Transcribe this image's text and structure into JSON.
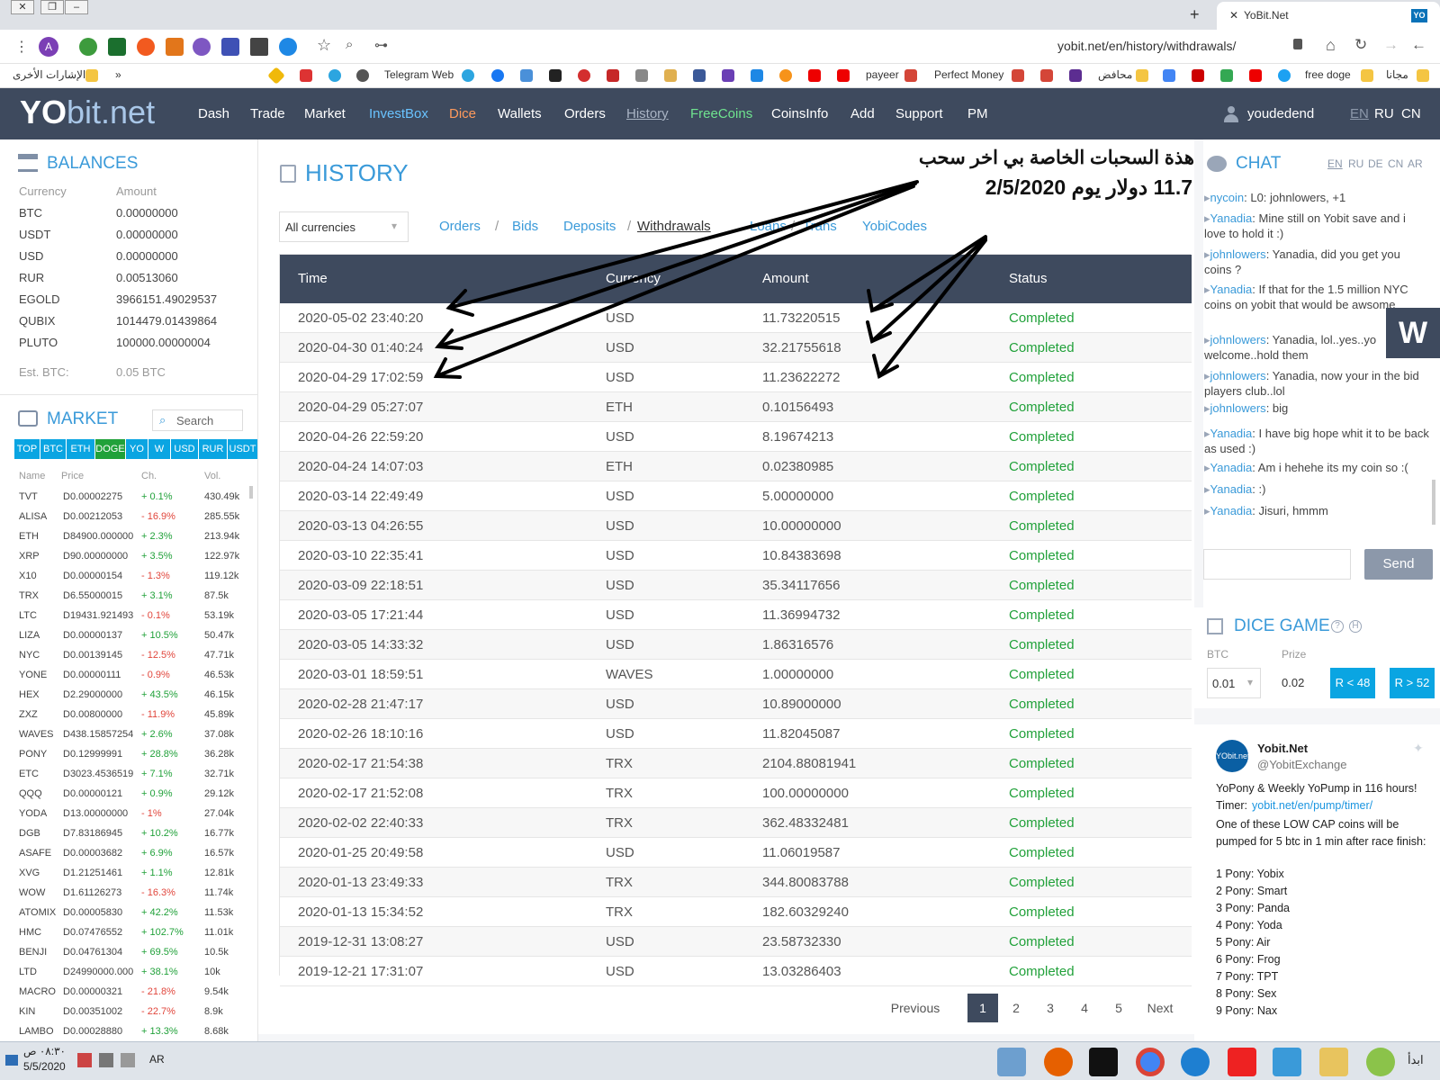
{
  "browser": {
    "tab_title": "YoBit.Net",
    "address": "yobit.net/en/history/withdrawals/",
    "profile_letter": "A",
    "ext_badge": "YO",
    "bookmarks": [
      {
        "label": "Telegram Web"
      },
      {
        "label": "payeer"
      },
      {
        "label": "Perfect Money"
      },
      {
        "label": "محافض"
      },
      {
        "label": "free doge"
      },
      {
        "label": "مجانا"
      }
    ],
    "bookmarks_other": "الإشارات الأخرى",
    "bookmarks_more": "»"
  },
  "nav": {
    "logo_yo": "YO",
    "logo_rest": "bit.net",
    "items": [
      "Dash",
      "Trade",
      "Market",
      "InvestBox",
      "Dice",
      "Wallets",
      "Orders",
      "History",
      "FreeCoins",
      "CoinsInfo",
      "Add",
      "Support",
      "PM"
    ],
    "username": "youdedend",
    "langs": [
      "EN",
      "RU",
      "CN"
    ]
  },
  "balances": {
    "title": "BALANCES",
    "col_currency": "Currency",
    "col_amount": "Amount",
    "rows": [
      {
        "currency": "BTC",
        "amount": "0.00000000"
      },
      {
        "currency": "USDT",
        "amount": "0.00000000"
      },
      {
        "currency": "USD",
        "amount": "0.00000000"
      },
      {
        "currency": "RUR",
        "amount": "0.00513060"
      },
      {
        "currency": "EGOLD",
        "amount": "3966151.49029537"
      },
      {
        "currency": "QUBIX",
        "amount": "1014479.01439864"
      },
      {
        "currency": "PLUTO",
        "amount": "100000.00000004"
      }
    ],
    "est_label": "Est. BTC:",
    "est_value": "0.05 BTC"
  },
  "market": {
    "title": "MARKET",
    "search_placeholder": "Search",
    "tabs": [
      "TOP",
      "BTC",
      "ETH",
      "DOGE",
      "YO",
      "W",
      "USD",
      "RUR",
      "USDT"
    ],
    "cols": [
      "Name",
      "Price",
      "Ch.",
      "Vol."
    ],
    "rows": [
      {
        "name": "TVT",
        "price": "D0.00002275",
        "ch": "+ 0.1%",
        "vol": "430.49k",
        "up": true
      },
      {
        "name": "ALISA",
        "price": "D0.00212053",
        "ch": "- 16.9%",
        "vol": "285.55k",
        "up": false
      },
      {
        "name": "ETH",
        "price": "D84900.000000",
        "ch": "+ 2.3%",
        "vol": "213.94k",
        "up": true
      },
      {
        "name": "XRP",
        "price": "D90.00000000",
        "ch": "+ 3.5%",
        "vol": "122.97k",
        "up": true
      },
      {
        "name": "X10",
        "price": "D0.00000154",
        "ch": "- 1.3%",
        "vol": "119.12k",
        "up": false
      },
      {
        "name": "TRX",
        "price": "D6.55000015",
        "ch": "+ 3.1%",
        "vol": "87.5k",
        "up": true
      },
      {
        "name": "LTC",
        "price": "D19431.921493",
        "ch": "- 0.1%",
        "vol": "53.19k",
        "up": false
      },
      {
        "name": "LIZA",
        "price": "D0.00000137",
        "ch": "+ 10.5%",
        "vol": "50.47k",
        "up": true
      },
      {
        "name": "NYC",
        "price": "D0.00139145",
        "ch": "- 12.5%",
        "vol": "47.71k",
        "up": false
      },
      {
        "name": "YONE",
        "price": "D0.00000111",
        "ch": "- 0.9%",
        "vol": "46.53k",
        "up": false
      },
      {
        "name": "HEX",
        "price": "D2.29000000",
        "ch": "+ 43.5%",
        "vol": "46.15k",
        "up": true
      },
      {
        "name": "ZXZ",
        "price": "D0.00800000",
        "ch": "- 11.9%",
        "vol": "45.89k",
        "up": false
      },
      {
        "name": "WAVES",
        "price": "D438.15857254",
        "ch": "+ 2.6%",
        "vol": "37.08k",
        "up": true
      },
      {
        "name": "PONY",
        "price": "D0.12999991",
        "ch": "+ 28.8%",
        "vol": "36.28k",
        "up": true
      },
      {
        "name": "ETC",
        "price": "D3023.4536519",
        "ch": "+ 7.1%",
        "vol": "32.71k",
        "up": true
      },
      {
        "name": "QQQ",
        "price": "D0.00000121",
        "ch": "+ 0.9%",
        "vol": "29.12k",
        "up": true
      },
      {
        "name": "YODA",
        "price": "D13.00000000",
        "ch": "- 1%",
        "vol": "27.04k",
        "up": false
      },
      {
        "name": "DGB",
        "price": "D7.83186945",
        "ch": "+ 10.2%",
        "vol": "16.77k",
        "up": true
      },
      {
        "name": "ASAFE",
        "price": "D0.00003682",
        "ch": "+ 6.9%",
        "vol": "16.57k",
        "up": true
      },
      {
        "name": "XVG",
        "price": "D1.21251461",
        "ch": "+ 1.1%",
        "vol": "12.81k",
        "up": true
      },
      {
        "name": "WOW",
        "price": "D1.61126273",
        "ch": "- 16.3%",
        "vol": "11.74k",
        "up": false
      },
      {
        "name": "ATOMIX",
        "price": "D0.00005830",
        "ch": "+ 42.2%",
        "vol": "11.53k",
        "up": true
      },
      {
        "name": "HMC",
        "price": "D0.07476552",
        "ch": "+ 102.7%",
        "vol": "11.01k",
        "up": true
      },
      {
        "name": "BENJI",
        "price": "D0.04761304",
        "ch": "+ 69.5%",
        "vol": "10.5k",
        "up": true
      },
      {
        "name": "LTD",
        "price": "D24990000.000",
        "ch": "+ 38.1%",
        "vol": "10k",
        "up": true
      },
      {
        "name": "MACRO",
        "price": "D0.00000321",
        "ch": "- 21.8%",
        "vol": "9.54k",
        "up": false
      },
      {
        "name": "KIN",
        "price": "D0.00351002",
        "ch": "- 22.7%",
        "vol": "8.9k",
        "up": false
      },
      {
        "name": "LAMBO",
        "price": "D0.00028880",
        "ch": "+ 13.3%",
        "vol": "8.68k",
        "up": true
      }
    ]
  },
  "history": {
    "title": "HISTORY",
    "currency_select": "All currencies",
    "links": [
      "Orders",
      "Bids",
      "Deposits",
      "Withdrawals",
      "Loans",
      "Trans",
      "YobiCodes"
    ],
    "columns": [
      "Time",
      "Currency",
      "Amount",
      "Status"
    ],
    "rows": [
      {
        "time": "2020-05-02 23:40:20",
        "currency": "USD",
        "amount": "11.73220515",
        "status": "Completed"
      },
      {
        "time": "2020-04-30 01:40:24",
        "currency": "USD",
        "amount": "32.21755618",
        "status": "Completed"
      },
      {
        "time": "2020-04-29 17:02:59",
        "currency": "USD",
        "amount": "11.23622272",
        "status": "Completed"
      },
      {
        "time": "2020-04-29 05:27:07",
        "currency": "ETH",
        "amount": "0.10156493",
        "status": "Completed"
      },
      {
        "time": "2020-04-26 22:59:20",
        "currency": "USD",
        "amount": "8.19674213",
        "status": "Completed"
      },
      {
        "time": "2020-04-24 14:07:03",
        "currency": "ETH",
        "amount": "0.02380985",
        "status": "Completed"
      },
      {
        "time": "2020-03-14 22:49:49",
        "currency": "USD",
        "amount": "5.00000000",
        "status": "Completed"
      },
      {
        "time": "2020-03-13 04:26:55",
        "currency": "USD",
        "amount": "10.00000000",
        "status": "Completed"
      },
      {
        "time": "2020-03-10 22:35:41",
        "currency": "USD",
        "amount": "10.84383698",
        "status": "Completed"
      },
      {
        "time": "2020-03-09 22:18:51",
        "currency": "USD",
        "amount": "35.34117656",
        "status": "Completed"
      },
      {
        "time": "2020-03-05 17:21:44",
        "currency": "USD",
        "amount": "11.36994732",
        "status": "Completed"
      },
      {
        "time": "2020-03-05 14:33:32",
        "currency": "USD",
        "amount": "1.86316576",
        "status": "Completed"
      },
      {
        "time": "2020-03-01 18:59:51",
        "currency": "WAVES",
        "amount": "1.00000000",
        "status": "Completed"
      },
      {
        "time": "2020-02-28 21:47:17",
        "currency": "USD",
        "amount": "10.89000000",
        "status": "Completed"
      },
      {
        "time": "2020-02-26 18:10:16",
        "currency": "USD",
        "amount": "11.82045087",
        "status": "Completed"
      },
      {
        "time": "2020-02-17 21:54:38",
        "currency": "TRX",
        "amount": "2104.88081941",
        "status": "Completed"
      },
      {
        "time": "2020-02-17 21:52:08",
        "currency": "TRX",
        "amount": "100.00000000",
        "status": "Completed"
      },
      {
        "time": "2020-02-02 22:40:33",
        "currency": "TRX",
        "amount": "362.48332481",
        "status": "Completed"
      },
      {
        "time": "2020-01-25 20:49:58",
        "currency": "USD",
        "amount": "11.06019587",
        "status": "Completed"
      },
      {
        "time": "2020-01-13 23:49:33",
        "currency": "TRX",
        "amount": "344.80083788",
        "status": "Completed"
      },
      {
        "time": "2020-01-13 15:34:52",
        "currency": "TRX",
        "amount": "182.60329240",
        "status": "Completed"
      },
      {
        "time": "2019-12-31 13:08:27",
        "currency": "USD",
        "amount": "23.58732330",
        "status": "Completed"
      },
      {
        "time": "2019-12-21 17:31:07",
        "currency": "USD",
        "amount": "13.03286403",
        "status": "Completed"
      }
    ],
    "pagination": {
      "previous": "Previous",
      "pages": [
        "1",
        "2",
        "3",
        "4",
        "5"
      ],
      "next": "Next",
      "current": "1"
    },
    "annotation_line1": "هذة السحبات الخاصة بي اخر سحب",
    "annotation_line2": "11.7 دولار يوم 2/5/2020"
  },
  "chat": {
    "title": "CHAT",
    "langs": [
      "EN",
      "RU",
      "DE",
      "CN",
      "AR"
    ],
    "messages": [
      {
        "name": "nycoin",
        "text": ": L0: johnlowers, +1"
      },
      {
        "name": "Yanadia",
        "text": ": Mine still on Yobit save and i love to hold it :)"
      },
      {
        "name": "johnlowers",
        "text": ": Yanadia, did you get you coins ?"
      },
      {
        "name": "Yanadia",
        "text": ": If that for the 1.5 million NYC coins on yobit that would be awsome"
      },
      {
        "name": "johnlowers",
        "text": ": Yanadia, lol..yes..yo welcome..hold them"
      },
      {
        "name": "johnlowers",
        "text": ": Yanadia, now your in the bid players club..lol"
      },
      {
        "name": "johnlowers",
        "text": ": big"
      },
      {
        "name": "Yanadia",
        "text": ": I have big hope whit it to be back as used :)"
      },
      {
        "name": "Yanadia",
        "text": ": Am i hehehe its my coin so :("
      },
      {
        "name": "Yanadia",
        "text": ": :)"
      },
      {
        "name": "Yanadia",
        "text": ": Jisuri, hmmm"
      }
    ],
    "send": "Send"
  },
  "dice": {
    "title": "DICE GAME",
    "btc_label": "BTC",
    "prize_label": "Prize",
    "bet": "0.01",
    "prize": "0.02",
    "btn_low": "R < 48",
    "btn_high": "R > 52"
  },
  "tweet": {
    "name": "Yobit.Net",
    "handle": "@YobitExchange",
    "line1": "YoPony & Weekly YoPump in 116 hours!",
    "timer_label": "Timer:",
    "timer_link": "yobit.net/en/pump/timer/",
    "body": "One of these LOW CAP coins will be pumped for 5 btc in 1 min after race finish:",
    "ponies": [
      "1 Pony: Yobix",
      "2 Pony: Smart",
      "3 Pony: Panda",
      "4 Pony: Yoda",
      "5 Pony: Air",
      "6 Pony: Frog",
      "7 Pony: TPT",
      "8 Pony: Sex",
      "9 Pony: Nax"
    ]
  },
  "taskbar": {
    "time": "٠٨:٣٠ ص",
    "date": "5/5/2020",
    "lang": "AR",
    "start": "ابدأ"
  }
}
